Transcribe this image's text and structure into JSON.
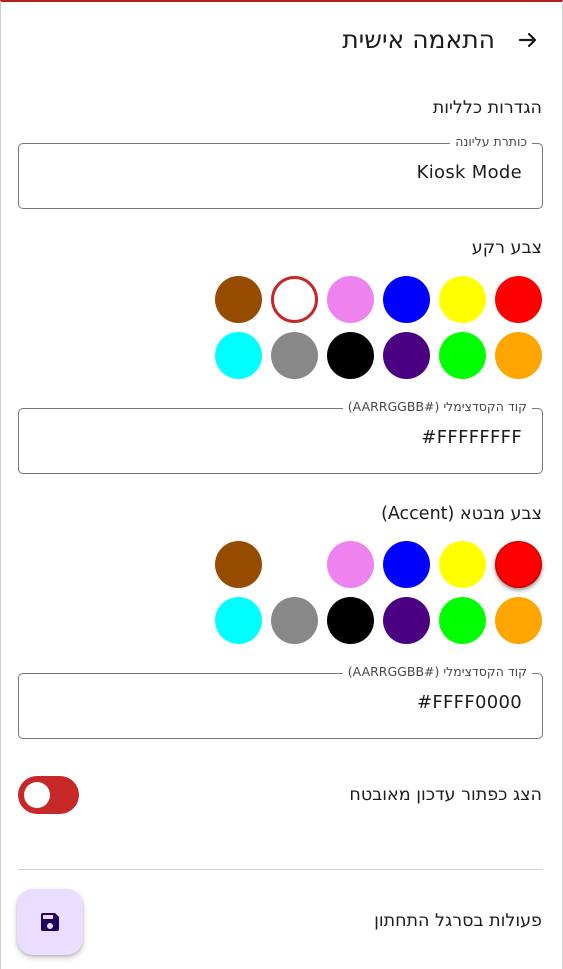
{
  "header": {
    "title": "התאמה אישית",
    "back_icon": "arrow-right-icon"
  },
  "general": {
    "label": "הגדרות כלליות",
    "top_title_field": {
      "label": "כותרת עליונה",
      "value": "Kiosk Mode"
    }
  },
  "background": {
    "label": "צבע רקע",
    "selected": "#FFFFFF",
    "swatches": [
      [
        "#FF0000",
        "#FFFF00",
        "#0000FF",
        "#EE82EE",
        "#FFFFFF",
        "#964B00"
      ],
      [
        "#FFA500",
        "#00FF00",
        "#4B0082",
        "#000000",
        "#888888",
        "#00FFFF"
      ]
    ],
    "hex_field": {
      "label": "קוד הקסדצימלי (#AARRGGBB)",
      "value": "#FFFFFFFF"
    }
  },
  "accent": {
    "label": "צבע מבטא (Accent)",
    "selected": "#FF0000",
    "swatches": [
      [
        "#FF0000",
        "#FFFF00",
        "#0000FF",
        "#EE82EE",
        "#FFFFFF",
        "#964B00"
      ],
      [
        "#FFA500",
        "#00FF00",
        "#4B0082",
        "#000000",
        "#888888",
        "#00FFFF"
      ]
    ],
    "hex_field": {
      "label": "קוד הקסדצימלי (#AARRGGBB)",
      "value": "#FFFF0000"
    }
  },
  "update_toggle": {
    "label": "הצג כפתור עדכון מאובטח",
    "state": "on",
    "color": "#C62828"
  },
  "bottom_bar": {
    "label": "פעולות בסרגל התחתון"
  },
  "fab": {
    "icon": "save-icon",
    "background": "#EADDFF",
    "icon_color": "#21005D"
  }
}
